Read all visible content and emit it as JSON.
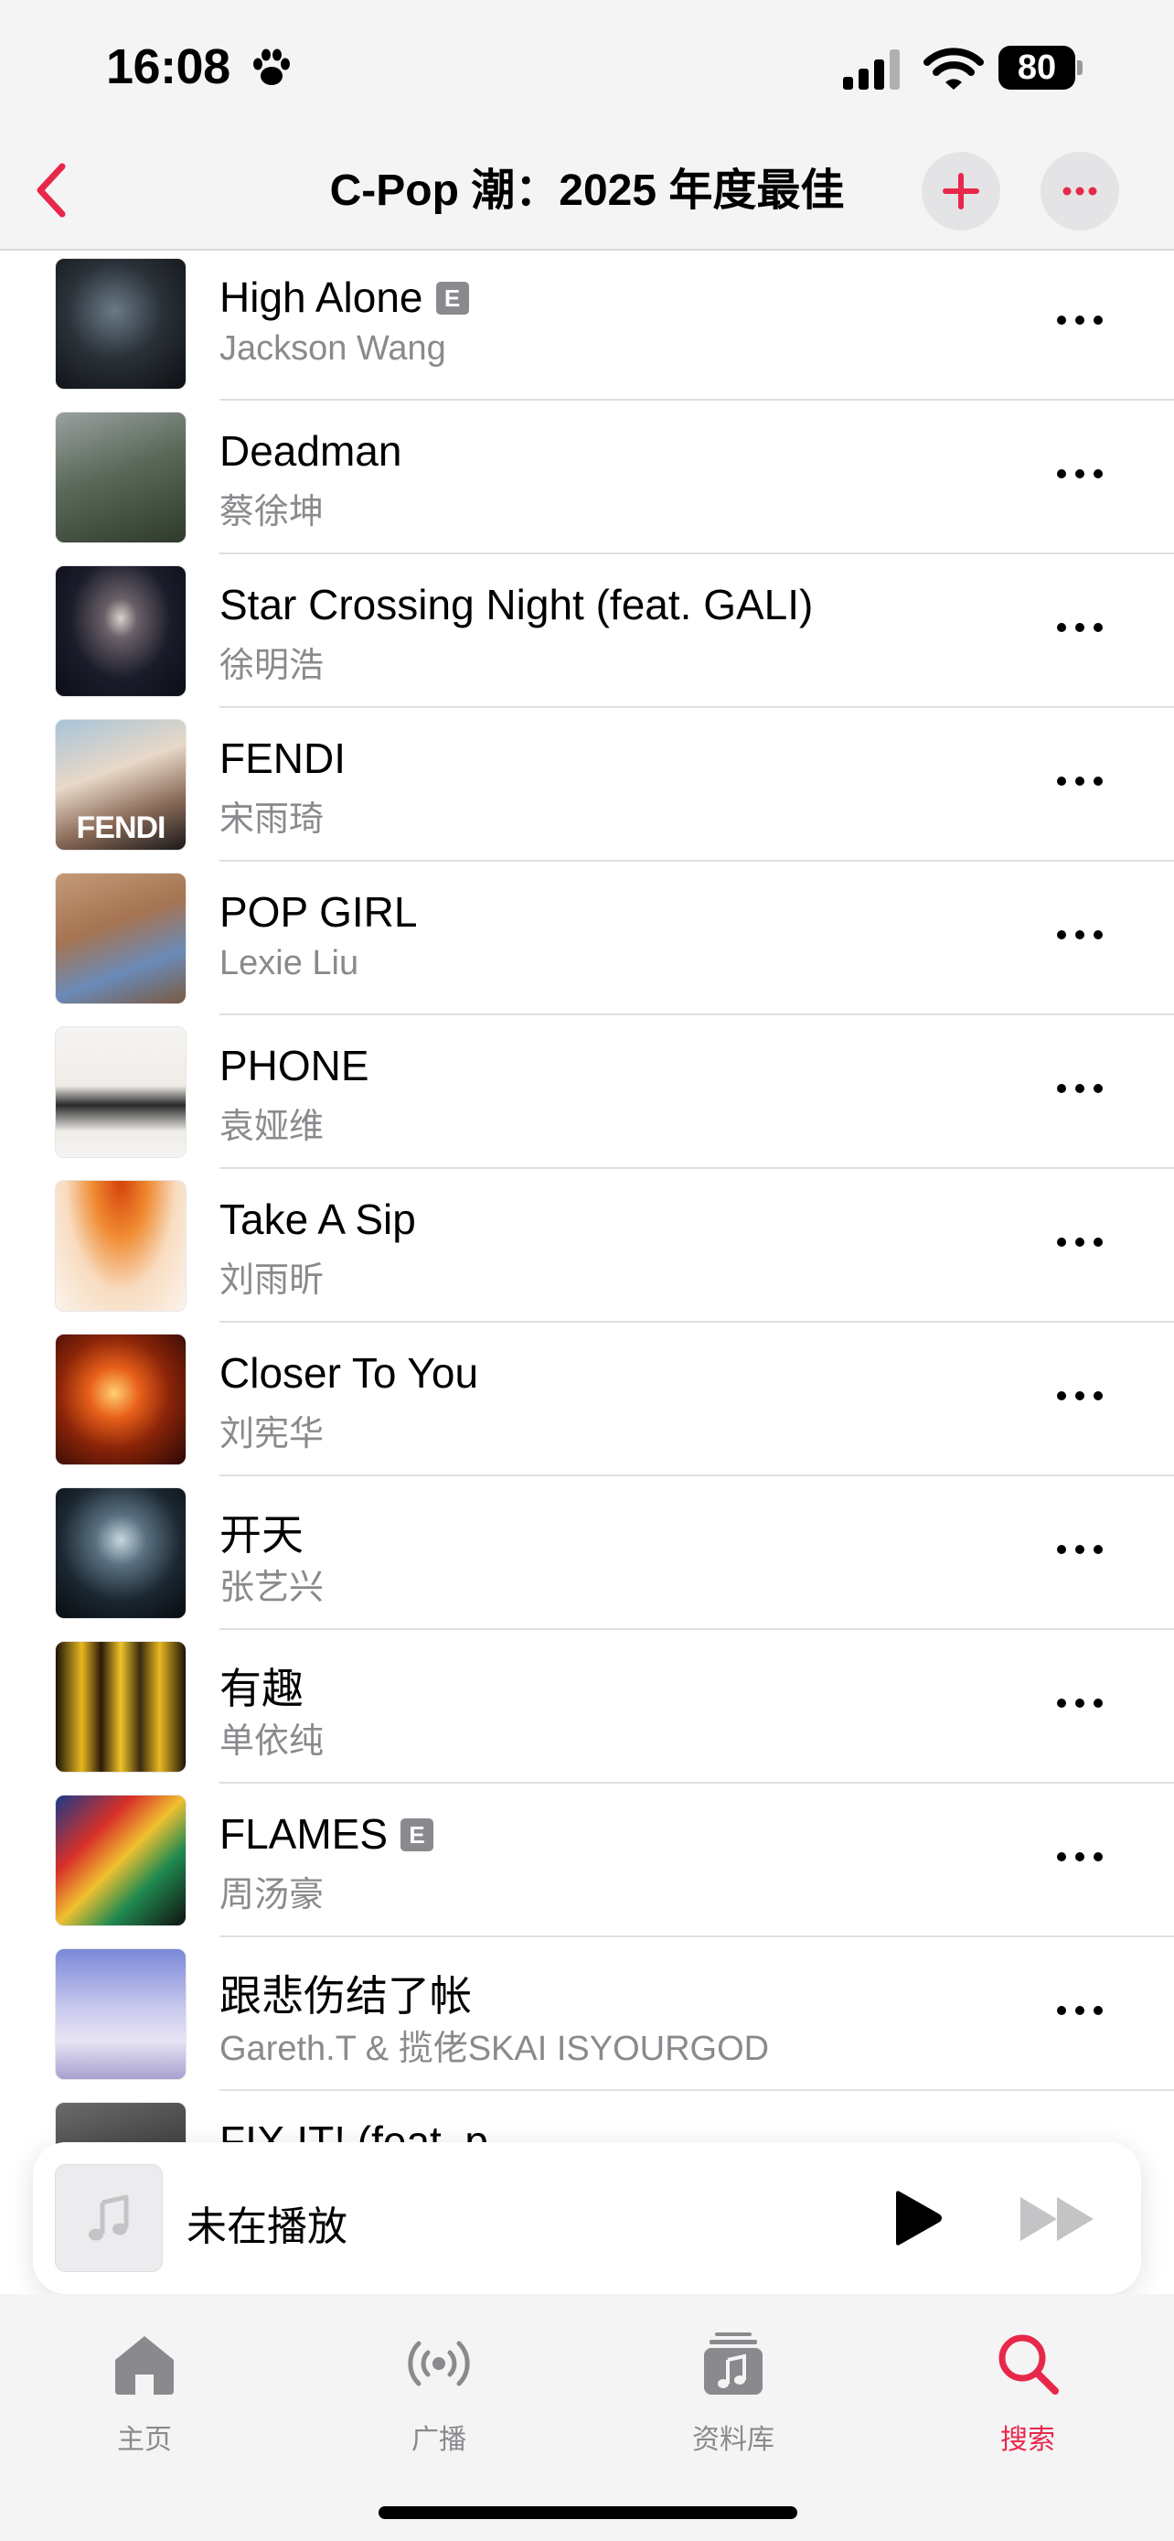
{
  "status_bar": {
    "time": "16:08",
    "battery": "80"
  },
  "nav": {
    "title": "C-Pop 潮：2025 年度最佳"
  },
  "tracks": [
    {
      "title": "High Alone",
      "artist": "Jackson Wang",
      "explicit": "E"
    },
    {
      "title": "Deadman",
      "artist": "蔡徐坤"
    },
    {
      "title": "Star Crossing Night (feat. GALI)",
      "artist": "徐明浩"
    },
    {
      "title": "FENDI",
      "artist": "宋雨琦",
      "art_text": "FENDI"
    },
    {
      "title": "POP GIRL",
      "artist": "Lexie Liu"
    },
    {
      "title": "PHONE",
      "artist": "袁娅维"
    },
    {
      "title": "Take A Sip",
      "artist": "刘雨昕"
    },
    {
      "title": "Closer To You",
      "artist": "刘宪华"
    },
    {
      "title": "开天",
      "artist": "张艺兴"
    },
    {
      "title": "有趣",
      "artist": "单依纯"
    },
    {
      "title": "FLAMES",
      "artist": "周汤豪",
      "explicit": "E"
    },
    {
      "title": "跟悲伤结了帐",
      "artist": "Gareth.T & 揽佬SKAI ISYOURGOD"
    },
    {
      "title": "FIX IT! (feat. p",
      "artist": ""
    }
  ],
  "mini_player": {
    "title": "未在播放"
  },
  "tabs": [
    {
      "label": "主页",
      "icon": "home-icon"
    },
    {
      "label": "广播",
      "icon": "radio-icon"
    },
    {
      "label": "资料库",
      "icon": "library-icon"
    },
    {
      "label": "搜索",
      "icon": "search-icon",
      "active": true
    }
  ],
  "colors": {
    "accent": "#e8284a",
    "secondary_text": "#8a8a8e",
    "bar_background": "#f4f4f5"
  }
}
